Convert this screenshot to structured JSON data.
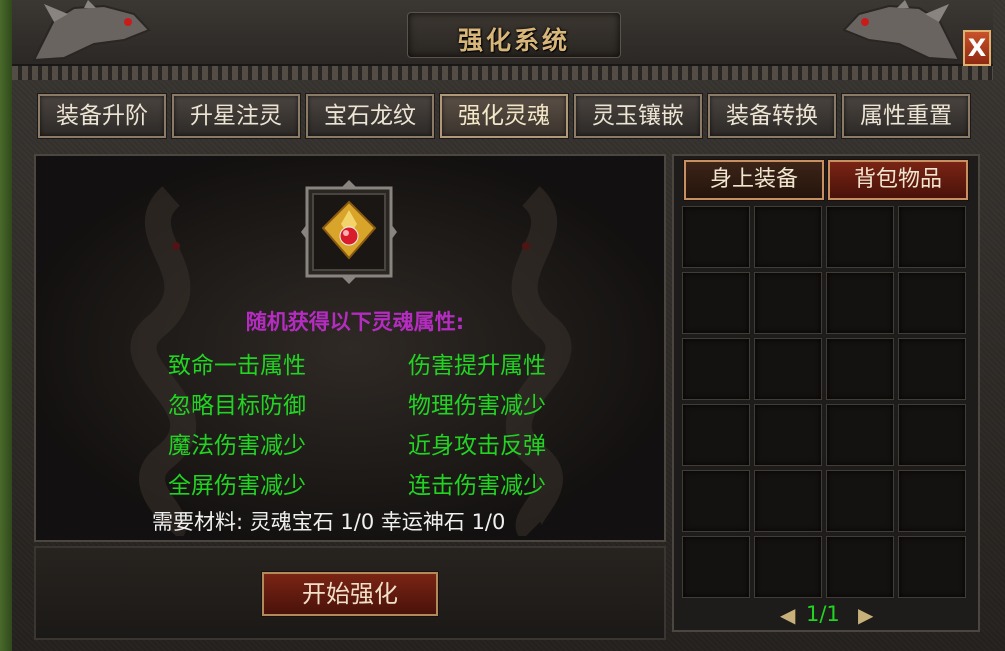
{
  "window": {
    "title": "强化系统",
    "close_label": "X"
  },
  "tabs": [
    {
      "label": "装备升阶"
    },
    {
      "label": "升星注灵"
    },
    {
      "label": "宝石龙纹"
    },
    {
      "label": "强化灵魂",
      "active": true
    },
    {
      "label": "灵玉镶嵌"
    },
    {
      "label": "装备转换"
    },
    {
      "label": "属性重置"
    }
  ],
  "main": {
    "prompt": "随机获得以下灵魂属性:",
    "attributes": [
      "致命一击属性",
      "伤害提升属性",
      "忽略目标防御",
      "物理伤害减少",
      "魔法伤害减少",
      "近身攻击反弹",
      "全屏伤害减少",
      "连击伤害减少"
    ],
    "requirement": "需要材料: 灵魂宝石 1/0 幸运神石 1/0",
    "start_button": "开始强化"
  },
  "inventory": {
    "tabs": [
      "身上装备",
      "背包物品"
    ],
    "page": "1/1"
  },
  "colors": {
    "attribute_green": "#22d422",
    "prompt_purple": "#b42cc0",
    "title_gold": "#d8b67a",
    "button_red": "#7a2414"
  }
}
